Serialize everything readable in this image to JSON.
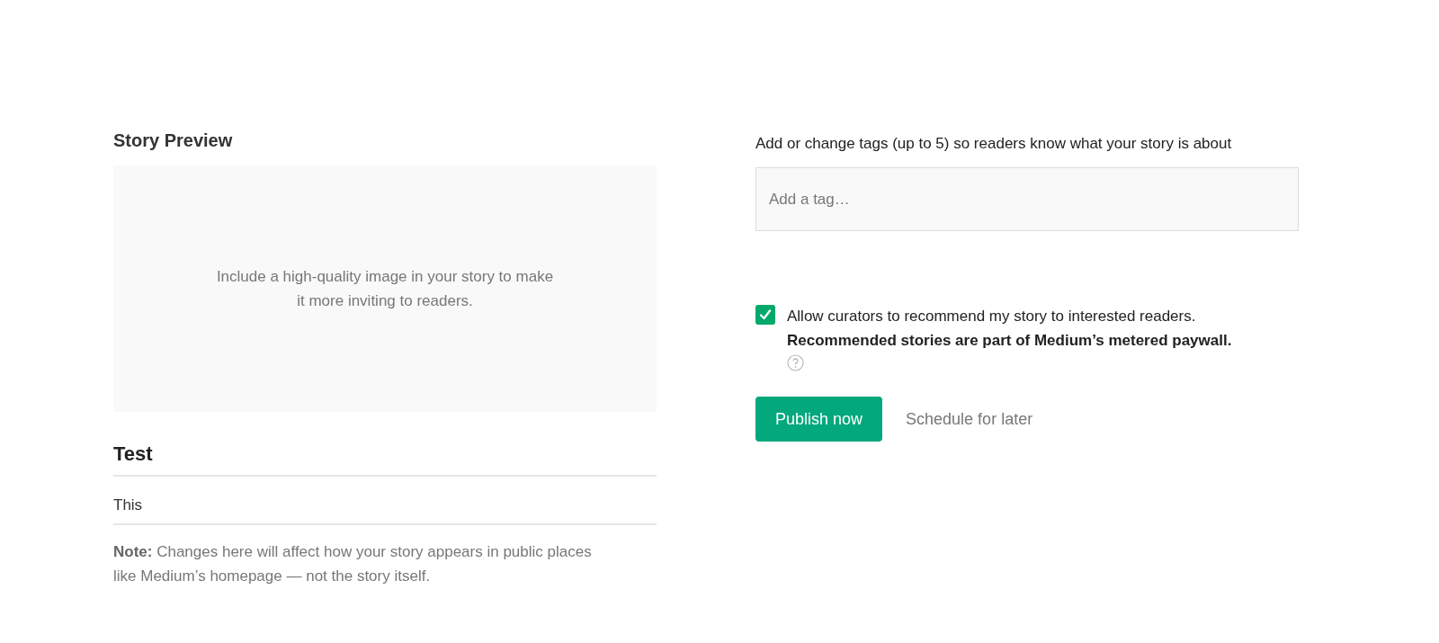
{
  "story_preview": {
    "heading": "Story Preview",
    "image_placeholder": {
      "text": "Include a high-quality image in your story to make it more inviting to readers."
    },
    "title_field": {
      "value": "Test"
    },
    "subtitle_field": {
      "value": "This"
    },
    "note": "**Note:** Changes here will affect how your story appears in public places like Medium’s homepage — not the story itself."
  },
  "publish": {
    "tags_label": "Add or change tags (up to 5) so readers know what your story is about",
    "tag_field": {
      "placeholder": "Add a tag…"
    },
    "recommend": {
      "checked": true,
      "text": "Allow curators to recommend my story to interested readers. **Recommended stories are part of Medium’s metered paywall.**"
    },
    "buttons": [
      {
        "kind": "primary",
        "label": "Publish now"
      },
      {
        "kind": "link",
        "label": "Schedule for later"
      }
    ]
  }
}
